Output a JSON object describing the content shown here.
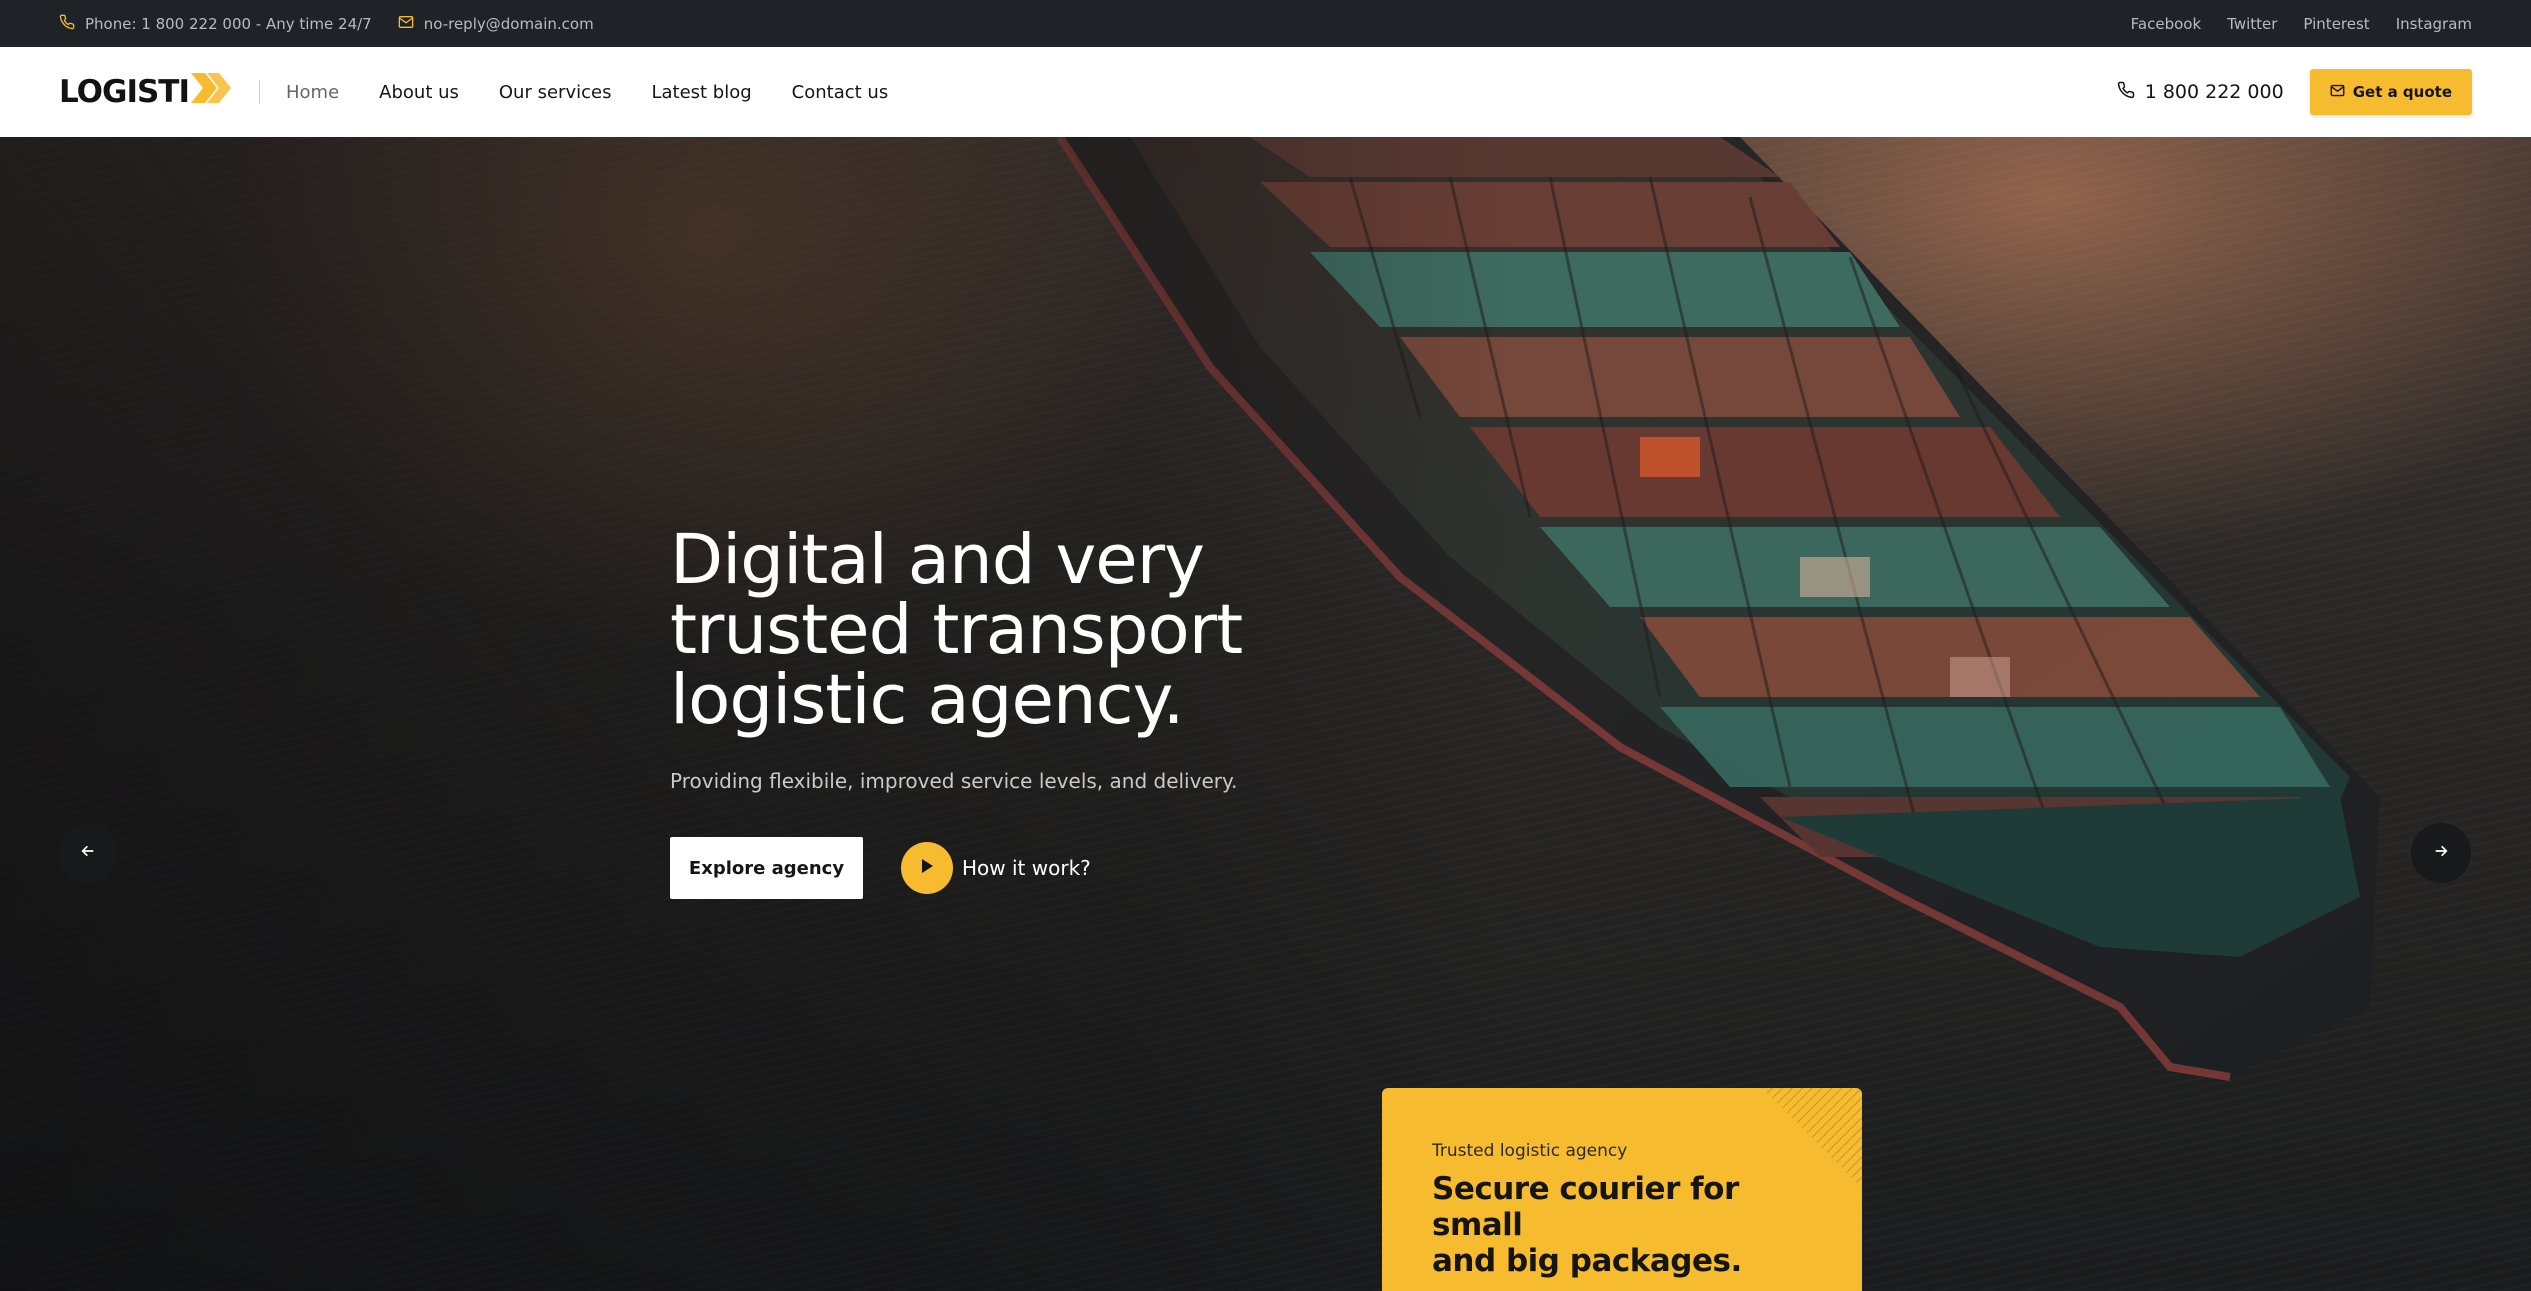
{
  "topbar": {
    "phone_text": "Phone: 1 800 222 000 - Any time 24/7",
    "email_text": "no-reply@domain.com",
    "social_links": [
      "Facebook",
      "Twitter",
      "Pinterest",
      "Instagram"
    ],
    "icons": [
      "phone-icon",
      "mail-icon"
    ]
  },
  "header": {
    "logo_text": "LOGISTI",
    "nav": [
      "Home",
      "About us",
      "Our services",
      "Latest blog",
      "Contact us"
    ],
    "active_nav": "Home",
    "phone": "1 800 222 000",
    "quote_button": "Get a quote"
  },
  "hero": {
    "title_lines": [
      "Digital and very",
      "trusted transport",
      "logistic agency."
    ],
    "subtitle": "Providing flexibile, improved service levels, and delivery.",
    "explore_button": "Explore agency",
    "play_label": "How it work?",
    "icons": [
      "arrow-left-icon",
      "arrow-right-icon",
      "play-icon"
    ]
  },
  "card": {
    "eyebrow": "Trusted logistic agency",
    "title_lines": [
      "Secure courier for small",
      "and big packages."
    ]
  },
  "colors": {
    "accent": "#f6bb2f",
    "topbar_bg": "#1f2327",
    "header_bg": "#ffffff"
  }
}
